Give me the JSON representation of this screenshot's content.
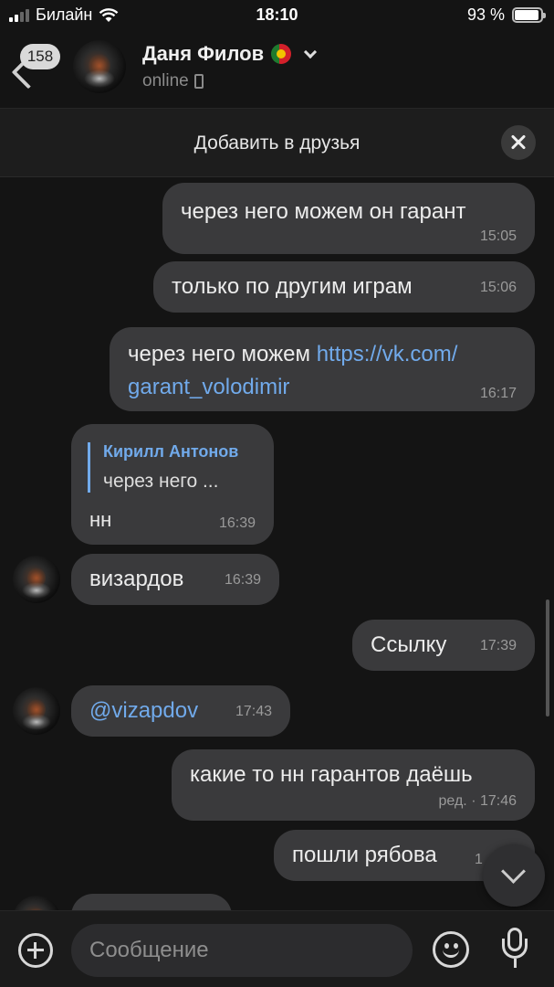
{
  "status_bar": {
    "carrier": "Билайн",
    "time": "18:10",
    "battery": "93 %",
    "battery_level": 0.93
  },
  "header": {
    "unread_count": "158",
    "name": "Даня Филов",
    "status": "online"
  },
  "add_friend": {
    "label": "Добавить в друзья"
  },
  "messages": [
    {
      "direction": "out",
      "text": "через него можем он гарант",
      "time": "15:05"
    },
    {
      "direction": "out",
      "text": "только по другим играм",
      "time": "15:06"
    },
    {
      "direction": "out",
      "text": "через него можем ",
      "link": "https://vk.com/",
      "link2": "garant_volodimir",
      "time": "16:17"
    },
    {
      "direction": "in",
      "quote_author": "Кирилл Антонов",
      "quote_text": "через него ...",
      "text": "нн",
      "time": "16:39"
    },
    {
      "direction": "in",
      "text": "визардов",
      "time": "16:39"
    },
    {
      "direction": "out",
      "text": "Ссылку",
      "time": "17:39"
    },
    {
      "direction": "in",
      "text": "@vizapdov",
      "time": "17:43"
    },
    {
      "direction": "out",
      "text": "какие то нн гарантов даёшь",
      "time": "ред. · 17:46"
    },
    {
      "direction": "out",
      "text": "пошли рябова",
      "time": "1"
    }
  ],
  "composer": {
    "placeholder": "Сообщение"
  },
  "icons": {
    "back": "chevron-left-icon",
    "close": "close-icon",
    "scroll_down": "chevron-down-icon",
    "attach": "plus-icon",
    "emoji": "smile-icon",
    "mic": "microphone-icon"
  },
  "colors": {
    "background": "#141414",
    "bubble": "#3a3a3c",
    "link": "#71aaeb"
  }
}
